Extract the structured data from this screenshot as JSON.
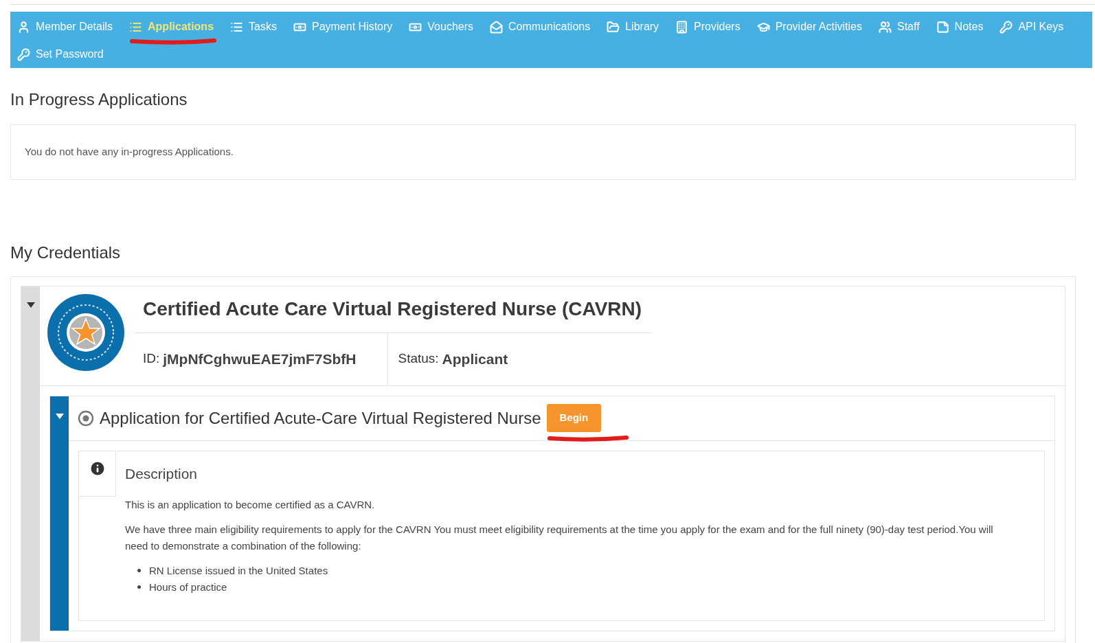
{
  "nav": {
    "items": [
      {
        "label": "Member Details",
        "selected": false,
        "underlined": false
      },
      {
        "label": "Applications",
        "selected": true,
        "underlined": true
      },
      {
        "label": "Tasks",
        "selected": false,
        "underlined": false
      },
      {
        "label": "Payment History",
        "selected": false,
        "underlined": false
      },
      {
        "label": "Vouchers",
        "selected": false,
        "underlined": false
      },
      {
        "label": "Communications",
        "selected": false,
        "underlined": false
      },
      {
        "label": "Library",
        "selected": false,
        "underlined": false
      },
      {
        "label": "Providers",
        "selected": false,
        "underlined": false
      },
      {
        "label": "Provider Activities",
        "selected": false,
        "underlined": false
      },
      {
        "label": "Staff",
        "selected": false,
        "underlined": false
      },
      {
        "label": "Notes",
        "selected": false,
        "underlined": false
      },
      {
        "label": "API Keys",
        "selected": false,
        "underlined": false
      },
      {
        "label": "Set Password",
        "selected": false,
        "underlined": false
      }
    ]
  },
  "in_progress": {
    "title": "In Progress Applications",
    "message": "You do not have any in-progress Applications."
  },
  "credentials": {
    "title": "My Credentials",
    "items": [
      {
        "expanded": true,
        "name": "Certified Acute Care Virtual Registered Nurse (CAVRN)",
        "id_label": "ID:",
        "id": "jMpNfCghwuEAE7jmF7SbfH",
        "status_label": "Status:",
        "status": "Applicant",
        "application": {
          "expanded": true,
          "title": "Application for Certified Acute-Care Virtual Registered Nurse",
          "button": "Begin",
          "button_underlined": true,
          "description": {
            "title": "Description",
            "paragraphs": [
              "This is an application to become certified as a CAVRN.",
              "We have three main eligibility requirements to apply for the CAVRN You must meet eligibility requirements at the time you apply for the exam and for the full ninety (90)-day test period.You will need to demonstrate a combination of the following:"
            ],
            "bullets": [
              "RN License issued in the United States",
              "Hours of practice"
            ]
          }
        }
      }
    ]
  }
}
